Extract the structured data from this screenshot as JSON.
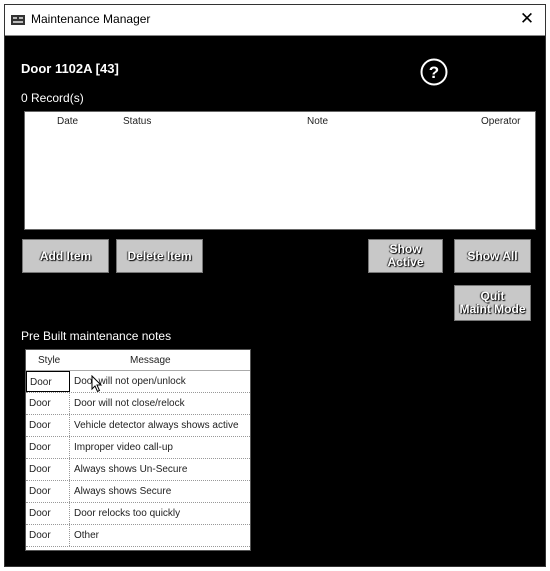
{
  "window": {
    "title": "Maintenance Manager",
    "close_label": "✕"
  },
  "header": {
    "door_title": "Door 1102A [43]",
    "record_count": "0 Record(s)"
  },
  "records_table": {
    "columns": [
      "Date",
      "Status",
      "Note",
      "Operator"
    ],
    "rows": []
  },
  "buttons": {
    "add_item": "Add Item",
    "delete_item": "Delete Item",
    "show_active": "Show Active",
    "show_all": "Show All",
    "quit_maint_line1": "Quit",
    "quit_maint_line2": "Maint Mode"
  },
  "notes": {
    "label": "Pre Built maintenance notes",
    "columns": [
      "Style",
      "Message"
    ],
    "rows": [
      {
        "style": "Door",
        "message": "Door will not open/unlock"
      },
      {
        "style": "Door",
        "message": "Door will not close/relock"
      },
      {
        "style": "Door",
        "message": "Vehicle detector always shows active"
      },
      {
        "style": "Door",
        "message": "Improper video call-up"
      },
      {
        "style": "Door",
        "message": "Always shows Un-Secure"
      },
      {
        "style": "Door",
        "message": "Always shows Secure"
      },
      {
        "style": "Door",
        "message": "Door relocks too quickly"
      },
      {
        "style": "Door",
        "message": "Other"
      }
    ]
  },
  "icons": {
    "app": "app-icon",
    "help": "help-icon",
    "close": "close-icon",
    "cursor": "mouse-pointer-icon"
  },
  "colors": {
    "background": "#000000",
    "button": "#c8c8c8",
    "table_bg": "#ffffff"
  }
}
